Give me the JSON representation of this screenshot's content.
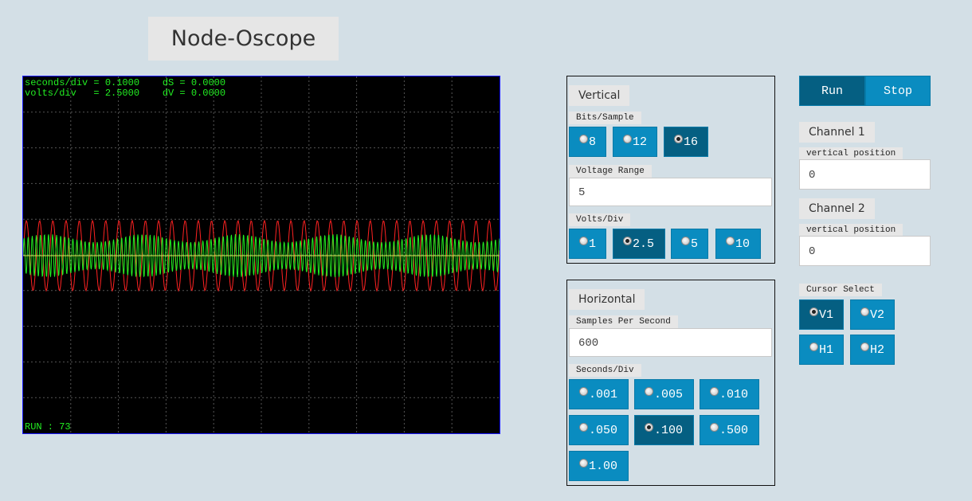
{
  "app": {
    "title": "Node-Oscope"
  },
  "scope": {
    "readout_line1": "seconds/div = 0.1000    dS = 0.0000",
    "readout_line2": "volts/div   = 2.5000    dV = 0.0000",
    "status": "RUN : 73",
    "colors": {
      "background": "#000000",
      "border": "#1a1aff",
      "grid": "#555555",
      "channel1": "#ff2222",
      "channel2": "#22ee22",
      "baseline": "#dddd55",
      "text": "#22ee22"
    }
  },
  "vertical": {
    "title": "Vertical",
    "bits_label": "Bits/Sample",
    "bits_options": [
      "8",
      "12",
      "16"
    ],
    "bits_selected": "16",
    "voltage_range_label": "Voltage Range",
    "voltage_range_value": "5",
    "volts_div_label": "Volts/Div",
    "volts_div_options": [
      "1",
      "2.5",
      "5",
      "10"
    ],
    "volts_div_selected": "2.5"
  },
  "horizontal": {
    "title": "Horizontal",
    "sps_label": "Samples Per Second",
    "sps_value": "600",
    "seconds_div_label": "Seconds/Div",
    "seconds_div_options": [
      ".001",
      ".005",
      ".010",
      ".050",
      ".100",
      ".500",
      "1.00"
    ],
    "seconds_div_selected": ".100"
  },
  "controls": {
    "run_label": "Run",
    "stop_label": "Stop",
    "channel1_title": "Channel 1",
    "channel1_pos_label": "vertical position",
    "channel1_pos_value": "0",
    "channel2_title": "Channel 2",
    "channel2_pos_label": "vertical position",
    "channel2_pos_value": "0",
    "cursor_label": "Cursor Select",
    "cursor_options": [
      "V1",
      "V2",
      "H1",
      "H2"
    ],
    "cursor_selected": "V1"
  }
}
